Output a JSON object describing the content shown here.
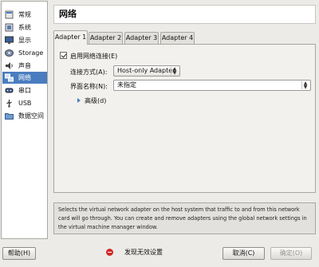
{
  "sidebar": {
    "items": [
      {
        "label": "常规",
        "icon": "general-settings-icon"
      },
      {
        "label": "系统",
        "icon": "system-chip-icon"
      },
      {
        "label": "显示",
        "icon": "display-monitor-icon"
      },
      {
        "label": "Storage",
        "icon": "storage-disk-icon"
      },
      {
        "label": "声音",
        "icon": "speaker-icon"
      },
      {
        "label": "网络",
        "icon": "network-icon",
        "selected": true
      },
      {
        "label": "串口",
        "icon": "serial-port-icon"
      },
      {
        "label": "USB",
        "icon": "usb-icon"
      },
      {
        "label": "数据空间",
        "icon": "shared-folder-icon"
      }
    ]
  },
  "header": {
    "title": "网络"
  },
  "tabs": [
    {
      "label": "Adapter 1",
      "active": true
    },
    {
      "label": "Adapter 2"
    },
    {
      "label": "Adapter 3"
    },
    {
      "label": "Adapter 4"
    }
  ],
  "panel": {
    "enable_label": "启用网络连接(E)",
    "enable_checked": true,
    "attached_label": "连接方式(A):",
    "attached_value": "Host-only Adapter",
    "name_label": "界面名称(N):",
    "name_value": "未指定",
    "advanced_label": "高级(d)"
  },
  "description": "Selects the virtual network adapter on the host system that traffic to and from this network card will go through. You can create and remove adapters using the global network settings in the virtual machine manager window.",
  "footer": {
    "help_label": "帮助(H)",
    "status_text": "发现无效设置",
    "cancel_label": "取消(C)",
    "ok_label": "确定(O)"
  },
  "colors": {
    "selection": "#4a7dbf",
    "warning": "#d32828"
  }
}
